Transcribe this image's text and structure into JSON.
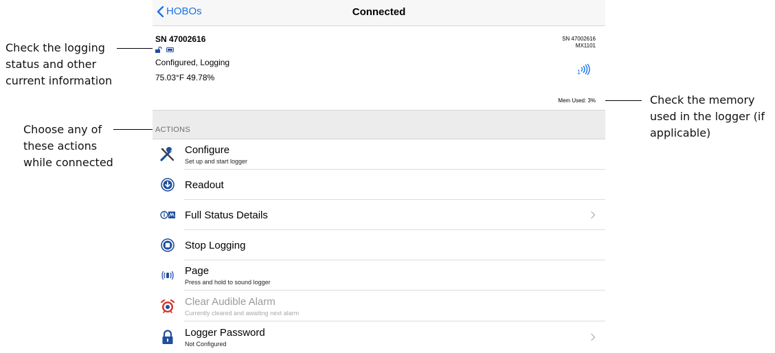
{
  "callouts": {
    "left_top": [
      "Check the logging",
      "status and other",
      "current information"
    ],
    "left_mid": [
      "Choose any of",
      "these actions",
      "while connected"
    ],
    "right": [
      "Check the memory",
      "used in the logger (if",
      "applicable)"
    ]
  },
  "nav": {
    "back_label": "HOBOs",
    "title": "Connected"
  },
  "device": {
    "sn": "SN 47002616",
    "status": "Configured, Logging",
    "readings": "75.03°F  49.78%",
    "sn_right": "SN 47002616",
    "model": "MX1101",
    "mem": "Mem Used: 3%"
  },
  "section_header": "ACTIONS",
  "actions": [
    {
      "title": "Configure",
      "subtitle": "Set up and start logger"
    },
    {
      "title": "Readout",
      "subtitle": ""
    },
    {
      "title": "Full Status Details",
      "subtitle": ""
    },
    {
      "title": "Stop Logging",
      "subtitle": ""
    },
    {
      "title": "Page",
      "subtitle": "Press and hold to sound logger"
    },
    {
      "title": "Clear Audible Alarm",
      "subtitle": "Currently cleared and awaiting next alarm"
    },
    {
      "title": "Logger Password",
      "subtitle": "Not Configured"
    }
  ],
  "colors": {
    "accent": "#1a73e8",
    "icon_blue": "#1f4e9c",
    "alarm_red": "#d9342b"
  }
}
